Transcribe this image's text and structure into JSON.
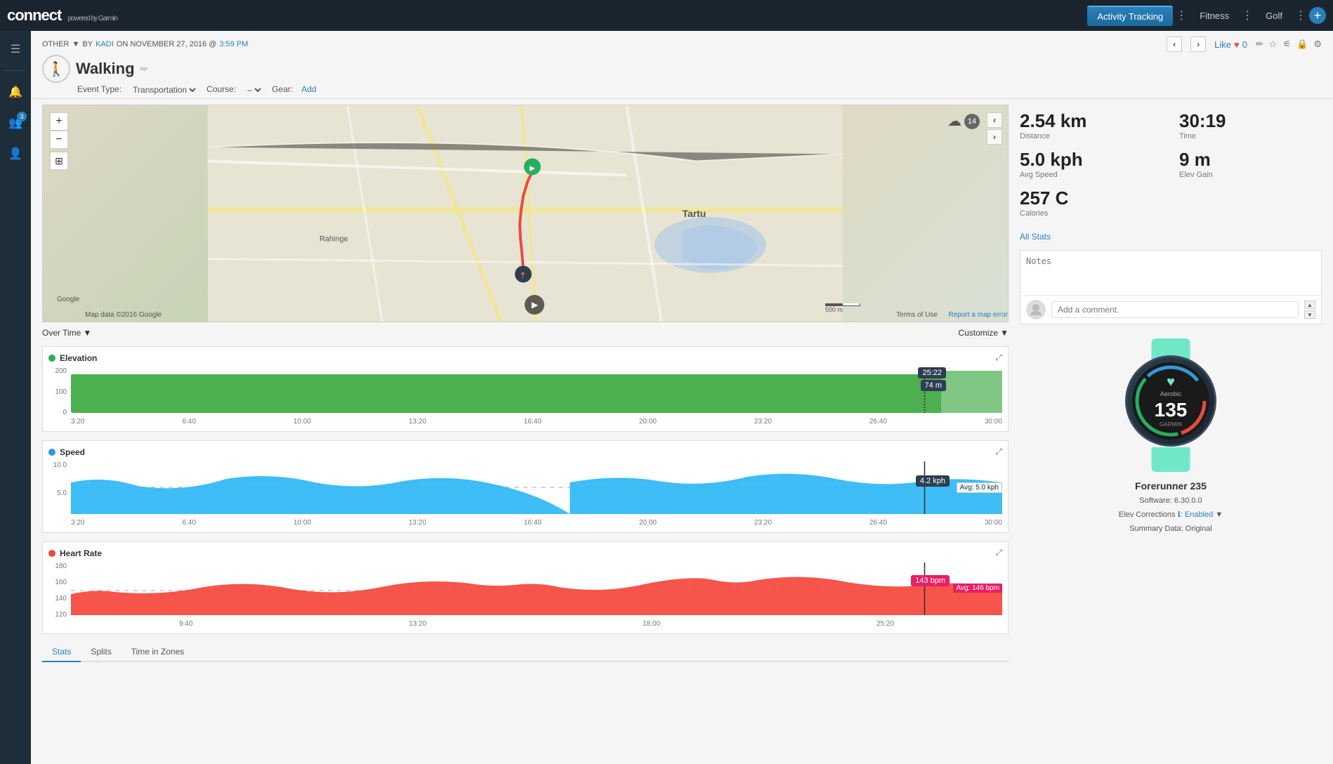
{
  "topNav": {
    "logo": "connect",
    "logoPowered": "powered by Garmin",
    "tabs": [
      {
        "id": "activity-tracking",
        "label": "Activity Tracking",
        "active": true
      },
      {
        "id": "fitness",
        "label": "Fitness",
        "active": false
      },
      {
        "id": "golf",
        "label": "Golf",
        "active": false
      }
    ],
    "plusLabel": "+"
  },
  "sidebar": {
    "icons": [
      {
        "id": "menu",
        "symbol": "☰"
      },
      {
        "id": "notifications",
        "symbol": "🔔",
        "badge": null
      },
      {
        "id": "users",
        "symbol": "👥",
        "badge": "3"
      },
      {
        "id": "user",
        "symbol": "👤"
      }
    ]
  },
  "breadcrumb": {
    "type": "OTHER",
    "by": "BY",
    "user": "KADI",
    "on": "ON NOVEMBER 27, 2016 @",
    "time": "3:59 PM"
  },
  "activity": {
    "title": "Walking",
    "iconSymbol": "🚶",
    "eventTypeLabel": "Event Type:",
    "eventType": "Transportation",
    "courseLabel": "Course:",
    "courseValue": "–",
    "gearLabel": "Gear:",
    "gearLink": "Add"
  },
  "likes": {
    "label": "Like",
    "count": "0"
  },
  "actionIcons": {
    "edit": "✏️",
    "star": "☆",
    "share": "🔗",
    "lock": "🔒",
    "settings": "⚙️"
  },
  "stats": {
    "distance": {
      "value": "2.54 km",
      "label": "Distance"
    },
    "time": {
      "value": "30:19",
      "label": "Time"
    },
    "avgSpeed": {
      "value": "5.0 kph",
      "label": "Avg Speed"
    },
    "elevGain": {
      "value": "9 m",
      "label": "Elev Gain"
    },
    "calories": {
      "value": "257 C",
      "label": "Calories"
    },
    "allStatsLink": "All Stats"
  },
  "notes": {
    "placeholder": "Notes",
    "commentPlaceholder": "Add a comment."
  },
  "charts": {
    "overTimeLabel": "Over Time",
    "customizeLabel": "Customize",
    "elevation": {
      "title": "Elevation",
      "yLabels": [
        "200",
        "100",
        "0"
      ],
      "color": "#4caf50",
      "xLabels": [
        "3:20",
        "6:40",
        "10:00",
        "13:20",
        "16:40",
        "20:00",
        "23:20",
        "26:40",
        "30:00"
      ],
      "tooltip": {
        "time": "25:22",
        "value": "74 m"
      }
    },
    "speed": {
      "title": "Speed",
      "yLabels": [
        "10.0",
        "5.0",
        ""
      ],
      "color": "#29b6f6",
      "xLabels": [
        "3:20",
        "6:40",
        "10:00",
        "13:20",
        "16:40",
        "20:00",
        "23:20",
        "26:40",
        "30:00"
      ],
      "tooltip": {
        "value": "4.2 kph"
      },
      "avg": "Avg: 5.0 kph"
    },
    "heartRate": {
      "title": "Heart Rate",
      "yLabels": [
        "180",
        "160",
        "140",
        "120"
      ],
      "color": "#f44336",
      "xLabels": [
        "",
        "9:40",
        "",
        "13:20",
        "",
        "18:00",
        "",
        "25:20",
        ""
      ],
      "tooltip": {
        "value": "143 bpm"
      },
      "avg": "Avg: 146 bpm"
    }
  },
  "device": {
    "name": "Forerunner 235",
    "software": "Software: 6.30.0.0",
    "elevCorrections": "Elev Corrections",
    "elevStatus": "Enabled",
    "summaryData": "Summary Data: Original",
    "bpm": "135",
    "watchLabel": "Aerobic",
    "brandLabel": "GARMIN"
  },
  "bottomTabs": [
    {
      "id": "stats",
      "label": "Stats",
      "active": true
    },
    {
      "id": "splits",
      "label": "Splits",
      "active": false
    },
    {
      "id": "time-in-zones",
      "label": "Time in Zones",
      "active": false
    }
  ],
  "map": {
    "googleText": "Google",
    "mapDataText": "Map data ©2016 Google",
    "scaleText": "500 m",
    "termsText": "Terms of Use",
    "reportText": "Report a map error"
  }
}
